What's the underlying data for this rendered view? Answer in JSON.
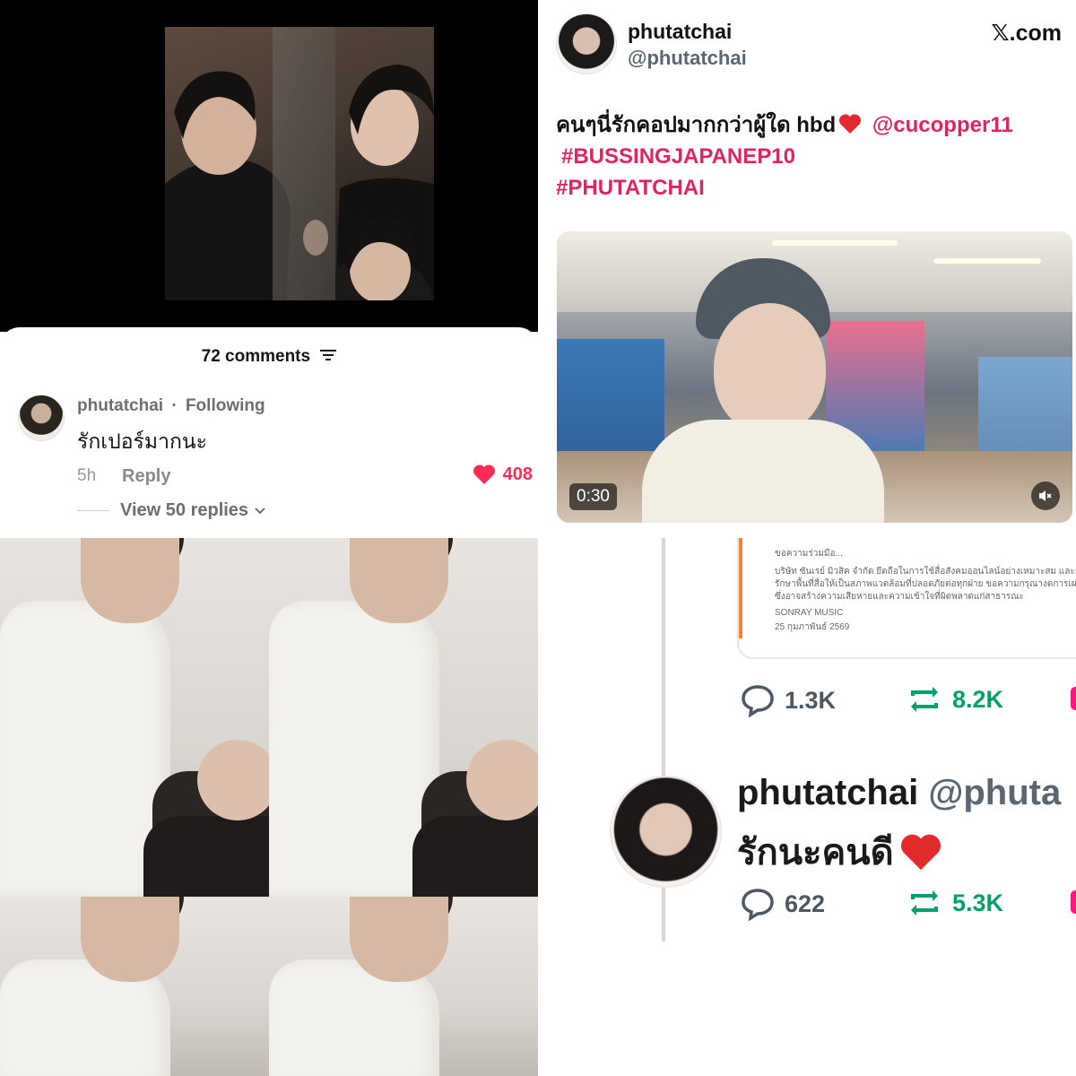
{
  "tiktok": {
    "comments_count": "72 comments",
    "comment": {
      "username": "phutatchai",
      "separator": "·",
      "status": "Following",
      "text": "รักเปอร์มากนะ",
      "time": "5h",
      "reply_label": "Reply",
      "likes": "408",
      "view_replies": "View 50 replies"
    }
  },
  "x_post": {
    "display_name": "phutatchai",
    "handle": "@phutatchai",
    "brand": "𝕏.com",
    "text_thai": "คนๆนี่รักคอปมากกว่าผู้ใด hbd",
    "mention": "@cucopper11",
    "hashtag1": "#BUSSINGJAPANEP10",
    "hashtag2": "#PHUTATCHAI",
    "video_duration": "0:30"
  },
  "x_thread": {
    "doc_lines": [
      "ขอความร่วมมือ...",
      "บริษัท ซันเรย์ มิวสิค จำกัด ยึดถือในการใช้สื่อสังคมออนไลน์อย่างเหมาะสม และสร้างสรรค์ เพื่อร",
      "รักษาพื้นที่สื่อให้เป็นสภาพแวดล้อมที่ปลอดภัยต่อทุกฝ่าย ขอความกรุณางดการเผยแพร่ข้อมูลอันเ",
      "ซึ่งอาจสร้างความเสียหายและความเข้าใจที่ผิดพลาดแก่สาธารณะ",
      "SONRAY MUSIC",
      "25 กุมภาพันธ์ 2569"
    ],
    "first_stats": {
      "replies": "1.3K",
      "reposts": "8.2K"
    },
    "reply": {
      "display_name": "phutatchai",
      "handle": "@phuta",
      "text": "รักนะคนดี",
      "replies": "622",
      "reposts": "5.3K"
    }
  },
  "colors": {
    "tiktok_like": "#fe2c55",
    "x_hashtag": "#e0245e",
    "x_repost": "#00a26a",
    "x_like": "#f91880"
  }
}
